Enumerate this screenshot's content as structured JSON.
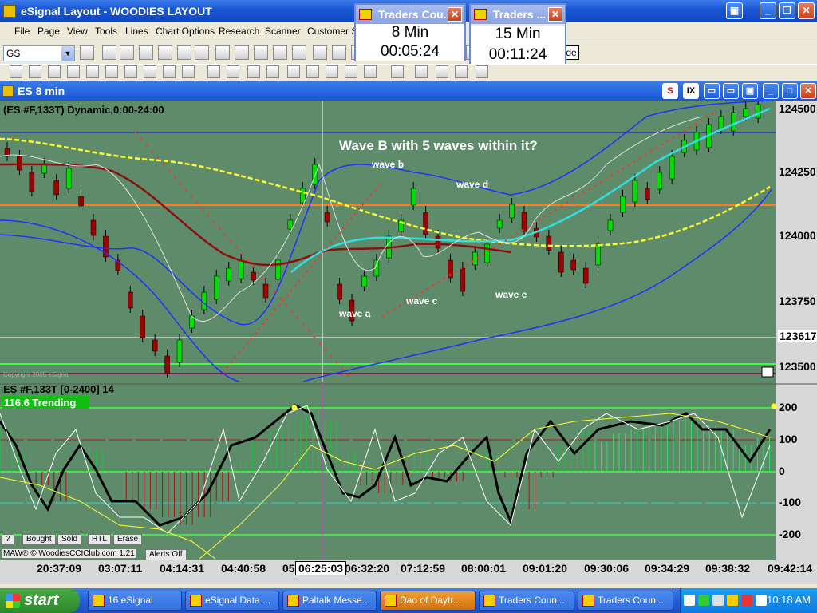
{
  "app": {
    "title": "eSignal Layout - WOODIES LAYOUT"
  },
  "menu": [
    "File",
    "Page",
    "View",
    "Tools",
    "Lines",
    "Chart Options",
    "Research",
    "Scanner",
    "Customer Su"
  ],
  "symbol_box": {
    "value": "GS"
  },
  "toolbar_partial_label": "de",
  "countdown_windows": [
    {
      "title": "Traders Cou...",
      "interval": "8 Min",
      "remaining": "00:05:24"
    },
    {
      "title": "Traders ...",
      "interval": "15 Min",
      "remaining": "00:11:24"
    }
  ],
  "chart_window": {
    "title": "ES  8 min",
    "buttons": [
      "S",
      "IX"
    ]
  },
  "price_pane": {
    "header": "(ES #F,133T) Dynamic,0:00-24:00",
    "copyright": "Copyright 2005 eSignal",
    "price_labels": [
      "124500",
      "124250",
      "124000",
      "123750",
      "123617",
      "123500"
    ],
    "current_price": "123617",
    "annotations": {
      "title": "Wave B with 5 waves within it?",
      "wave_a": "wave a",
      "wave_b": "wave b",
      "wave_c": "wave c",
      "wave_d": "wave d",
      "wave_e": "wave e"
    }
  },
  "cci_pane": {
    "header": "ES #F,133T [0-2400] 14",
    "trend_badge": "116.6 Trending",
    "levels": [
      "200",
      "100",
      "0",
      "-100",
      "-200"
    ],
    "buttons": [
      "?",
      "Bought",
      "Sold",
      "HTL",
      "Erase"
    ],
    "footer": "MAW® © WoodiesCCIClub.com 1.21",
    "alerts": "Alerts Off"
  },
  "time_axis": [
    "20:37:09",
    "03:07:11",
    "04:14:31",
    "04:40:58",
    "05",
    "06:25:03",
    "06:32:20",
    "07:12:59",
    "08:00:01",
    "09:01:20",
    "09:30:06",
    "09:34:29",
    "09:38:32",
    "09:42:14"
  ],
  "taskbar": {
    "start": "start",
    "tasks": [
      "16 eSignal",
      "eSignal Data ...",
      "Paltalk Messe...",
      "Dao of Daytr...",
      "Traders Coun...",
      "Traders Coun..."
    ],
    "clock": "10:18 AM"
  },
  "colors": {
    "chart_bg": "#5e8c6a",
    "price_axis_bg": "#d8d8d8",
    "bull_candle": "#00e000",
    "bear_candle": "#a00000"
  }
}
